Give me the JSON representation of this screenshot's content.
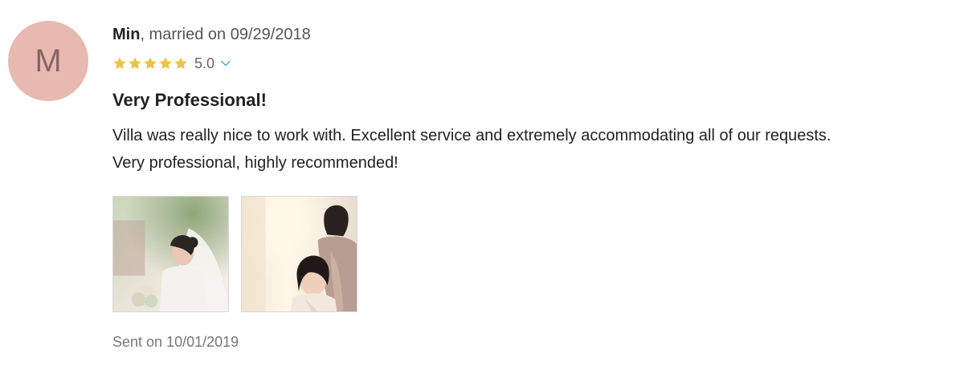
{
  "avatar": {
    "initial": "M",
    "color": "#e8b9b0"
  },
  "reviewer": {
    "name": "Min",
    "married_text": ", married on 09/29/2018"
  },
  "rating": {
    "stars": 5,
    "max_stars": 5,
    "value_text": "5.0",
    "star_color": "#f0c048",
    "expand_icon": "chevron-down-icon"
  },
  "review": {
    "title": "Very Professional!",
    "body_line1": "Villa was really nice to work with. Excellent service and extremely accommodating all of our requests.",
    "body_line2": "Very professional, highly recommended!"
  },
  "photos": [
    {
      "subject": "bride-with-veil-outdoors"
    },
    {
      "subject": "bride-getting-hair-styled"
    }
  ],
  "footer": {
    "sent_on": "Sent on 10/01/2019"
  }
}
